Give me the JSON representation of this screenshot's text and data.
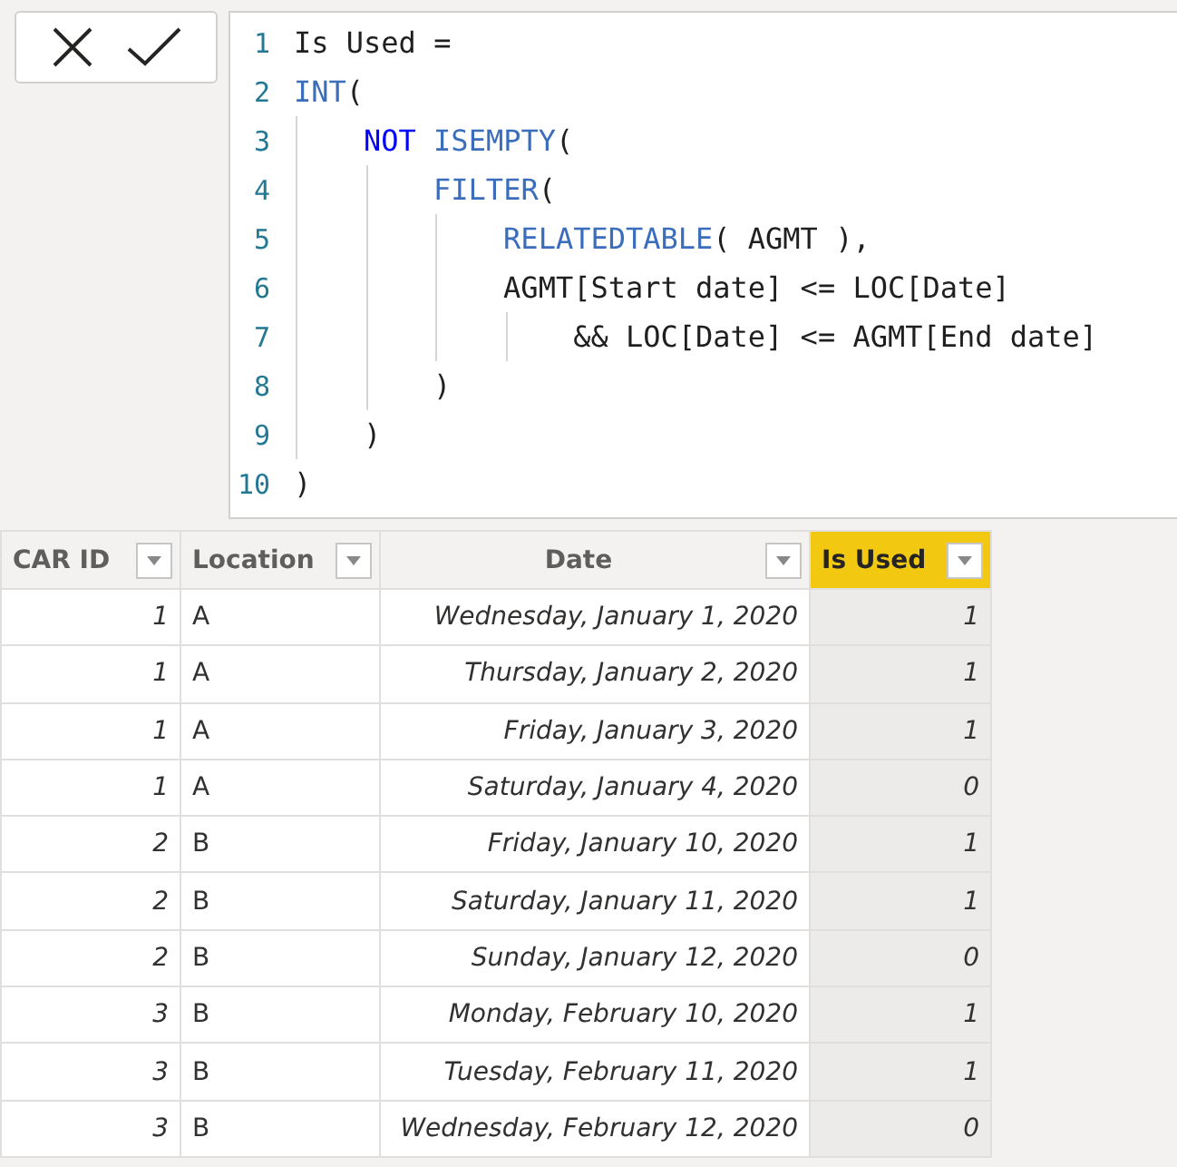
{
  "formula_bar": {
    "buttons": [
      {
        "kind": "cancel"
      },
      {
        "kind": "commit"
      }
    ],
    "lines": [
      {
        "number": "1",
        "tokens": [
          {
            "kind": "plain",
            "text": "Is Used ="
          }
        ]
      },
      {
        "number": "2",
        "tokens": [
          {
            "kind": "function",
            "text": "INT"
          },
          {
            "kind": "plain",
            "text": "("
          }
        ],
        "children": [
          {
            "number": "3",
            "tokens": [
              {
                "kind": "keyword",
                "text": "NOT",
                "spaced": true
              },
              {
                "kind": "function",
                "text": "ISEMPTY"
              },
              {
                "kind": "plain",
                "text": "("
              }
            ],
            "children": [
              {
                "number": "4",
                "tokens": [
                  {
                    "kind": "function",
                    "text": "FILTER"
                  },
                  {
                    "kind": "plain",
                    "text": "("
                  }
                ],
                "children": [
                  {
                    "number": "5",
                    "tokens": [
                      {
                        "kind": "function",
                        "text": "RELATEDTABLE"
                      },
                      {
                        "kind": "plain",
                        "text": "( AGMT ),"
                      }
                    ]
                  },
                  {
                    "number": "6",
                    "tokens": [
                      {
                        "kind": "plain",
                        "text": "AGMT[Start date] <= LOC[Date]"
                      }
                    ],
                    "children": [
                      {
                        "number": "7",
                        "tokens": [
                          {
                            "kind": "plain",
                            "text": "&& LOC[Date] <= AGMT[End date]"
                          }
                        ]
                      }
                    ]
                  }
                ]
              },
              {
                "number": "8",
                "tokens": [
                  {
                    "kind": "plain",
                    "text": ")"
                  }
                ]
              }
            ]
          },
          {
            "number": "9",
            "tokens": [
              {
                "kind": "plain",
                "text": ")"
              }
            ]
          }
        ]
      },
      {
        "number": "10",
        "tokens": [
          {
            "kind": "plain",
            "text": ")"
          }
        ]
      }
    ]
  },
  "table": {
    "columns": [
      {
        "label": "CAR ID",
        "kind": "number",
        "selected": false
      },
      {
        "label": "Location",
        "kind": "text",
        "selected": false
      },
      {
        "label": "Date",
        "kind": "number",
        "selected": false
      },
      {
        "label": "Is Used",
        "kind": "number",
        "selected": true
      }
    ],
    "rows": [
      [
        "1",
        "A",
        "Wednesday, January 1, 2020",
        "1"
      ],
      [
        "1",
        "A",
        "Thursday, January 2, 2020",
        "1"
      ],
      [
        "1",
        "A",
        "Friday, January 3, 2020",
        "1"
      ],
      [
        "1",
        "A",
        "Saturday, January 4, 2020",
        "0"
      ],
      [
        "2",
        "B",
        "Friday, January 10, 2020",
        "1"
      ],
      [
        "2",
        "B",
        "Saturday, January 11, 2020",
        "1"
      ],
      [
        "2",
        "B",
        "Sunday, January 12, 2020",
        "0"
      ],
      [
        "3",
        "B",
        "Monday, February 10, 2020",
        "1"
      ],
      [
        "3",
        "B",
        "Tuesday, February 11, 2020",
        "1"
      ],
      [
        "3",
        "B",
        "Wednesday, February 12, 2020",
        "0"
      ]
    ]
  }
}
